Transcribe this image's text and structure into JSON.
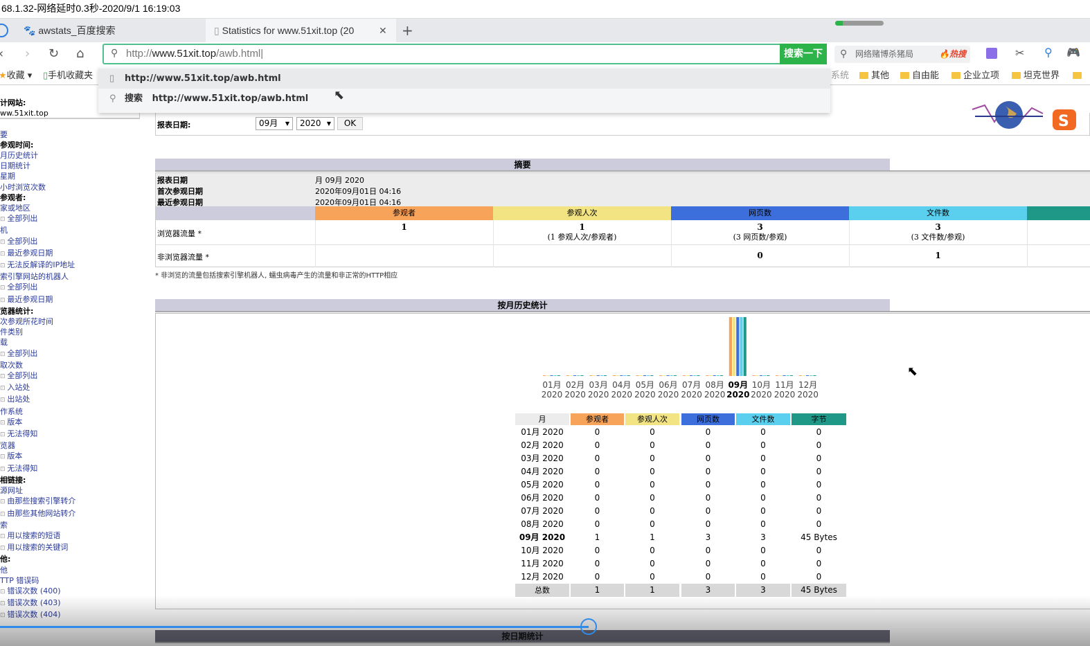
{
  "status_line": "68.1.32-网络延时0.3秒-2020/9/1 16:19:03",
  "tabs": [
    {
      "label": "awstats_百度搜索",
      "icon": "paw-icon"
    },
    {
      "label": "Statistics for www.51xit.top (20",
      "icon": "page-icon"
    }
  ],
  "loading_progress": 0.15,
  "address": {
    "prefix": "http://",
    "host": "www.51xit.top",
    "path": "/awb.html",
    "search_button": "搜索一下"
  },
  "search_box": {
    "placeholder": "网络赌博杀猪局",
    "hot": "热搜"
  },
  "bookmarks": {
    "left": [
      "收藏",
      "手机收藏夹"
    ],
    "right_partial": "系统",
    "folders": [
      "其他",
      "自由能",
      "企业立项",
      "坦克世界"
    ]
  },
  "suggestions": [
    {
      "icon": "page-icon",
      "text": "http://www.51xit.top/awb.html"
    },
    {
      "icon": "search-icon",
      "prefix": "搜索",
      "text": "http://www.51xit.top/awb.html"
    }
  ],
  "sidebar": {
    "site_label": "计网站:",
    "site_value": "ww.51xit.top",
    "items": [
      {
        "t": "要",
        "k": "link"
      },
      {
        "t": "参观时间:",
        "k": "hd"
      },
      {
        "t": "月历史统计",
        "k": "link"
      },
      {
        "t": "日期统计",
        "k": "link"
      },
      {
        "t": "星期",
        "k": "link"
      },
      {
        "t": "小时浏览次数",
        "k": "link"
      },
      {
        "t": "参观者:",
        "k": "hd"
      },
      {
        "t": "家或地区",
        "k": "link"
      },
      {
        "t": "全部列出",
        "k": "sub"
      },
      {
        "t": "机",
        "k": "link"
      },
      {
        "t": "全部列出",
        "k": "sub"
      },
      {
        "t": "最近参观日期",
        "k": "sub"
      },
      {
        "t": "无法反解译的IP地址",
        "k": "sub"
      },
      {
        "t": "索引擎网站的机器人",
        "k": "link"
      },
      {
        "t": "全部列出",
        "k": "sub"
      },
      {
        "t": "最近参观日期",
        "k": "sub"
      },
      {
        "t": "览器统计:",
        "k": "hd"
      },
      {
        "t": "次参观所花时间",
        "k": "link"
      },
      {
        "t": "件类别",
        "k": "link"
      },
      {
        "t": "载",
        "k": "link"
      },
      {
        "t": "全部列出",
        "k": "sub"
      },
      {
        "t": "取次数",
        "k": "link"
      },
      {
        "t": "全部列出",
        "k": "sub"
      },
      {
        "t": "入站处",
        "k": "sub"
      },
      {
        "t": "出站处",
        "k": "sub"
      },
      {
        "t": "作系统",
        "k": "link"
      },
      {
        "t": "版本",
        "k": "sub"
      },
      {
        "t": "无法得知",
        "k": "sub"
      },
      {
        "t": "览器",
        "k": "link"
      },
      {
        "t": "版本",
        "k": "sub"
      },
      {
        "t": "无法得知",
        "k": "sub"
      },
      {
        "t": "相链接:",
        "k": "hd"
      },
      {
        "t": "源网址",
        "k": "link"
      },
      {
        "t": "由那些搜索引擎转介",
        "k": "sub"
      },
      {
        "t": "由那些其他网站转介",
        "k": "sub"
      },
      {
        "t": "索",
        "k": "link"
      },
      {
        "t": "用以搜索的短语",
        "k": "sub"
      },
      {
        "t": "用以搜索的关键词",
        "k": "sub"
      },
      {
        "t": "他:",
        "k": "hd"
      },
      {
        "t": "他",
        "k": "link"
      },
      {
        "t": "TTP 错误码",
        "k": "link"
      },
      {
        "t": "错误次数 (400)",
        "k": "sub"
      },
      {
        "t": "错误次数 (403)",
        "k": "sub"
      },
      {
        "t": "错误次数 (404)",
        "k": "sub"
      }
    ]
  },
  "report_date": {
    "label": "报表日期:",
    "month": "09月",
    "year": "2020",
    "ok": "OK"
  },
  "summary": {
    "title": "摘要",
    "rows": [
      {
        "k": "报表日期",
        "v": "月 09月 2020"
      },
      {
        "k": "首次参观日期",
        "v": "2020年09月01日 04:16"
      },
      {
        "k": "最近参观日期",
        "v": "2020年09月01日 04:16"
      }
    ],
    "columns": [
      "参观者",
      "参观人次",
      "网页数",
      "文件数"
    ],
    "browser_label": "浏览器流量 *",
    "browser": [
      {
        "v": "1",
        "s": ""
      },
      {
        "v": "1",
        "s": "(1 参观人次/参观者)"
      },
      {
        "v": "3",
        "s": "(3 网页数/参观)"
      },
      {
        "v": "3",
        "s": "(3 文件数/参观)"
      }
    ],
    "nonbrowser_label": "非浏览器流量 *",
    "nonbrowser": [
      "",
      "",
      "0",
      "1"
    ],
    "footnote": "* 非浏览的流量包括搜索引擎机器人, 蠕虫病毒产生的流量和非正常的HTTP相应"
  },
  "colors": {
    "visitors": "#f8a35a",
    "visits": "#f2e383",
    "pages": "#3d6fdc",
    "hits": "#5bcfee",
    "bytes": "#1f9887",
    "header": "#ccccdd"
  },
  "monthly": {
    "title": "按月历史统计",
    "headers": [
      "月",
      "参观者",
      "参观人次",
      "网页数",
      "文件数",
      "字节"
    ],
    "rows": [
      [
        "01月 2020",
        "0",
        "0",
        "0",
        "0",
        "0"
      ],
      [
        "02月 2020",
        "0",
        "0",
        "0",
        "0",
        "0"
      ],
      [
        "03月 2020",
        "0",
        "0",
        "0",
        "0",
        "0"
      ],
      [
        "04月 2020",
        "0",
        "0",
        "0",
        "0",
        "0"
      ],
      [
        "05月 2020",
        "0",
        "0",
        "0",
        "0",
        "0"
      ],
      [
        "06月 2020",
        "0",
        "0",
        "0",
        "0",
        "0"
      ],
      [
        "07月 2020",
        "0",
        "0",
        "0",
        "0",
        "0"
      ],
      [
        "08月 2020",
        "0",
        "0",
        "0",
        "0",
        "0"
      ],
      [
        "09月 2020",
        "1",
        "1",
        "3",
        "3",
        "45 Bytes"
      ],
      [
        "10月 2020",
        "0",
        "0",
        "0",
        "0",
        "0"
      ],
      [
        "11月 2020",
        "0",
        "0",
        "0",
        "0",
        "0"
      ],
      [
        "12月 2020",
        "0",
        "0",
        "0",
        "0",
        "0"
      ]
    ],
    "total": [
      "总数",
      "1",
      "1",
      "3",
      "3",
      "45 Bytes"
    ],
    "current_month": "09月 2020"
  },
  "chart_data": {
    "type": "bar",
    "categories": [
      "01月 2020",
      "02月 2020",
      "03月 2020",
      "04月 2020",
      "05月 2020",
      "06月 2020",
      "07月 2020",
      "08月 2020",
      "09月 2020",
      "10月 2020",
      "11月 2020",
      "12月 2020"
    ],
    "series": [
      {
        "name": "参观者",
        "values": [
          0,
          0,
          0,
          0,
          0,
          0,
          0,
          0,
          1,
          0,
          0,
          0
        ]
      },
      {
        "name": "参观人次",
        "values": [
          0,
          0,
          0,
          0,
          0,
          0,
          0,
          0,
          1,
          0,
          0,
          0
        ]
      },
      {
        "name": "网页数",
        "values": [
          0,
          0,
          0,
          0,
          0,
          0,
          0,
          0,
          3,
          0,
          0,
          0
        ]
      },
      {
        "name": "文件数",
        "values": [
          0,
          0,
          0,
          0,
          0,
          0,
          0,
          0,
          3,
          0,
          0,
          0
        ]
      },
      {
        "name": "字节",
        "values": [
          0,
          0,
          0,
          0,
          0,
          0,
          0,
          0,
          45,
          0,
          0,
          0
        ]
      }
    ]
  },
  "next_section": "按日期统计",
  "video_progress": 0.54
}
